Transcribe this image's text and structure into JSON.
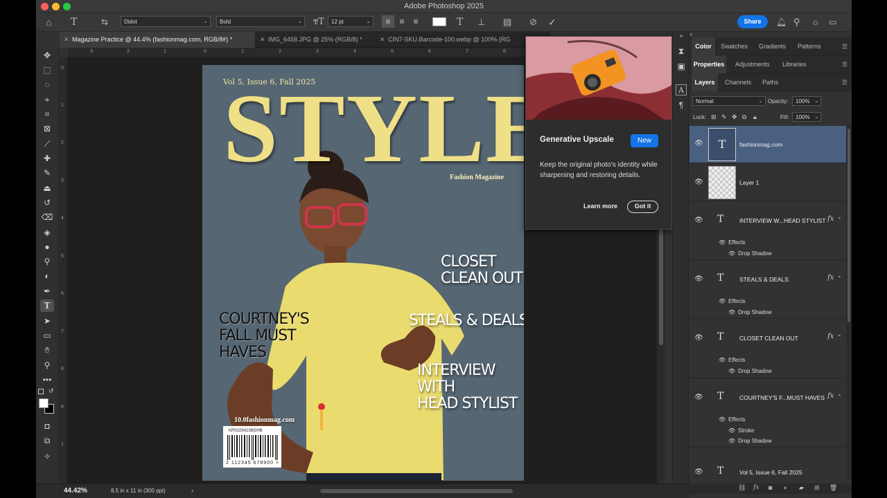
{
  "window": {
    "title": "Adobe Photoshop 2025"
  },
  "options_bar": {
    "font_family": "Didot",
    "font_style": "Bold",
    "font_size": "12 pt",
    "share_label": "Share"
  },
  "tabs": [
    {
      "label": "Magazine Practice @ 44.4% (fashionmag.com, RGB/8#) *",
      "active": true
    },
    {
      "label": "IMG_6458.JPG @ 25% (RGB/8) *",
      "active": false
    },
    {
      "label": "CIN7-SKU.Barcode-100.webp @ 100% (RG",
      "active": false
    }
  ],
  "rulers": {
    "top": [
      "3",
      "2",
      "1",
      "0",
      "1",
      "2",
      "3",
      "4",
      "5",
      "6",
      "7",
      "8"
    ],
    "left": [
      "0",
      "1",
      "2",
      "3",
      "4",
      "5",
      "6",
      "7",
      "8",
      "9",
      "1"
    ]
  },
  "document": {
    "issue_line": "Vol 5, Issue 6, Fall 2025",
    "masthead": "STYLE",
    "tagline": "Fashion Magazine",
    "headline_courtney": [
      "COURTNEY'S",
      "FALL MUST",
      "HAVES"
    ],
    "headline_closet": [
      "CLOSET",
      "CLEAN OUT"
    ],
    "headline_steals": "STEALS & DEALS",
    "headline_interview": [
      "INTERVIEW",
      "WITH",
      "HEAD STYLIST"
    ],
    "url_text": "10.0fashionmag.com",
    "barcode_top": "KR5325423BGHB",
    "barcode_bottom": "2 112345 678900 >"
  },
  "popup": {
    "title": "Generative Upscale",
    "badge": "New",
    "body": "Keep the original photo's identity while sharpening and restoring details.",
    "learn_more": "Learn more",
    "got_it": "Got it"
  },
  "panels": {
    "top_tabs": [
      "Color",
      "Swatches",
      "Gradients",
      "Patterns"
    ],
    "mid_tabs": [
      "Properties",
      "Adjustments",
      "Libraries"
    ],
    "layer_tabs": [
      "Layers",
      "Channels",
      "Paths"
    ],
    "blend_mode": "Normal",
    "opacity_label": "Opacity:",
    "opacity_value": "100%",
    "lock_label": "Lock:",
    "fill_label": "Fill:",
    "fill_value": "100%"
  },
  "layers": [
    {
      "name": "fashionmag.com",
      "kind": "text-thumb",
      "selected": true
    },
    {
      "name": "Layer 1",
      "kind": "pixel-thumb"
    },
    {
      "name": "INTERVIEW  W...HEAD STYLIST",
      "kind": "text",
      "effects": [
        "Drop Shadow"
      ]
    },
    {
      "name": "STEALS & DEALS",
      "kind": "text",
      "effects": [
        "Drop Shadow"
      ]
    },
    {
      "name": "CLOSET CLEAN OUT",
      "kind": "text",
      "effects": [
        "Drop Shadow"
      ]
    },
    {
      "name": "COURTNEY'S F...MUST  HAVES",
      "kind": "text",
      "effects": [
        "Stroke",
        "Drop Shadow"
      ]
    },
    {
      "name": "Vol 5, Issue 6, Fall 2025",
      "kind": "text"
    }
  ],
  "effects_label": "Effects",
  "status": {
    "zoom": "44.42%",
    "doc_size": "8.5 in x 11 in (300 ppi)",
    "arrow": "›"
  },
  "colors": {
    "accent": "#1473e6",
    "selected_layer": "#4a6081",
    "cover_bg": "#566673",
    "masthead": "#efdf86"
  }
}
